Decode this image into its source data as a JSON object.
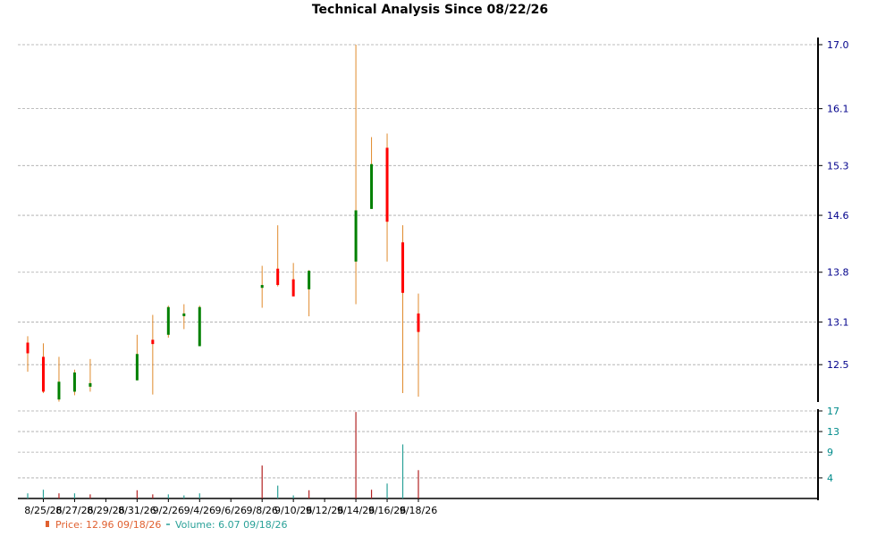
{
  "chart_data": [
    {
      "type": "candlestick",
      "title": "Technical Analysis Since 08/22/26",
      "x": [
        "8/24/26",
        "8/25/26",
        "8/26/26",
        "8/27/26",
        "8/28/26",
        "8/31/26",
        "9/1/26",
        "9/2/26",
        "9/3/26",
        "9/4/26",
        "9/8/26",
        "9/9/26",
        "9/10/26",
        "9/11/26",
        "9/14/26",
        "9/15/26",
        "9/16/26",
        "9/17/26",
        "9/18/26"
      ],
      "x_ticks": [
        "8/25/26",
        "8/27/26",
        "8/29/26",
        "8/31/26",
        "9/2/26",
        "9/4/26",
        "9/6/26",
        "9/8/26",
        "9/10/26",
        "9/12/26",
        "9/14/26",
        "9/16/26",
        "9/18/26"
      ],
      "y_ticks": [
        "17.0",
        "16.1",
        "15.3",
        "14.6",
        "13.8",
        "13.1",
        "12.5"
      ],
      "ylim": [
        12.0,
        17.0
      ],
      "series": [
        {
          "open": [
            12.81,
            12.61,
            12.01,
            12.12,
            12.19,
            12.28,
            12.85,
            12.92,
            13.22,
            12.76,
            13.58,
            13.85,
            13.7,
            13.56,
            13.95,
            14.69,
            15.55,
            14.22,
            13.22
          ],
          "high": [
            12.9,
            12.8,
            12.61,
            12.43,
            12.58,
            12.92,
            13.2,
            13.33,
            13.35,
            13.33,
            13.89,
            14.46,
            13.93,
            13.83,
            17.0,
            15.7,
            15.75,
            14.46,
            13.5
          ],
          "low": [
            12.4,
            12.1,
            11.98,
            12.07,
            12.12,
            12.28,
            12.08,
            12.88,
            13.0,
            12.76,
            13.3,
            13.6,
            13.48,
            13.18,
            13.35,
            14.69,
            13.95,
            12.1,
            12.05
          ],
          "close": [
            12.66,
            12.12,
            12.26,
            12.39,
            12.24,
            12.65,
            12.79,
            13.31,
            13.22,
            13.31,
            13.62,
            13.62,
            13.46,
            13.82,
            14.67,
            15.32,
            14.51,
            13.51,
            12.96
          ]
        }
      ]
    },
    {
      "type": "bar",
      "x": [
        "8/24/26",
        "8/25/26",
        "8/26/26",
        "8/27/26",
        "8/28/26",
        "8/31/26",
        "9/1/26",
        "9/2/26",
        "9/3/26",
        "9/4/26",
        "9/8/26",
        "9/9/26",
        "9/10/26",
        "9/11/26",
        "9/14/26",
        "9/15/26",
        "9/16/26",
        "9/17/26",
        "9/18/26"
      ],
      "y_ticks": [
        "17",
        "13",
        "9",
        "4"
      ],
      "ylim": [
        0,
        17
      ],
      "series": [
        {
          "values": [
            1.0,
            1.7,
            1.0,
            1.0,
            0.8,
            1.6,
            0.8,
            0.8,
            0.6,
            1.0,
            6.4,
            2.5,
            0.6,
            1.6,
            16.8,
            1.7,
            2.9,
            10.5,
            5.5
          ],
          "up": [
            true,
            true,
            false,
            true,
            false,
            false,
            false,
            true,
            true,
            true,
            false,
            true,
            true,
            false,
            false,
            false,
            true,
            true,
            false
          ]
        }
      ]
    }
  ],
  "legend": {
    "price_label": "Price: 12.96  09/18/26",
    "volume_label": "Volume: 6.07  09/18/26"
  },
  "colors": {
    "up": "#008000",
    "down": "#ff0000",
    "wick": "#e08a2c",
    "vol_down": "#b22222",
    "vol_up": "#2aa198",
    "grid": "#a9a9a9",
    "price_axis_text": "#00008b",
    "volume_axis_text": "#008b8b",
    "legend_price": "#e06030",
    "legend_volume": "#2aa198"
  }
}
